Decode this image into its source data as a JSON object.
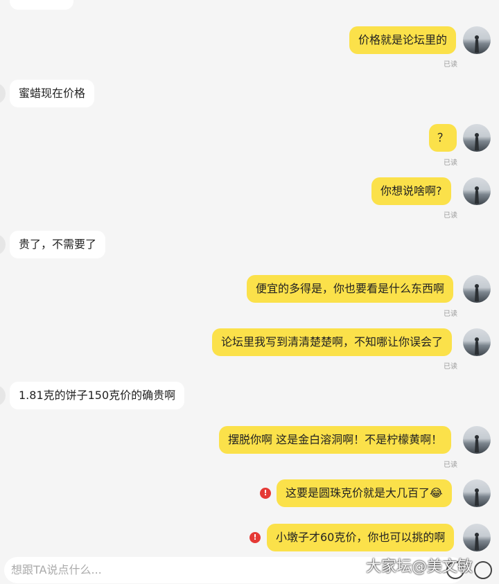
{
  "messages": [
    {
      "dir": "out",
      "text": "价格就是论坛里的",
      "read": "已读",
      "error": false
    },
    {
      "dir": "in",
      "text": "蜜蜡现在价格"
    },
    {
      "dir": "out",
      "text": "？",
      "read": "已读",
      "error": false
    },
    {
      "dir": "out",
      "text": "你想说啥啊?",
      "read": "已读",
      "error": false
    },
    {
      "dir": "in",
      "text": "贵了，不需要了"
    },
    {
      "dir": "out",
      "text": "便宜的多得是，你也要看是什么东西啊",
      "read": "已读",
      "error": false
    },
    {
      "dir": "out",
      "text": "论坛里我写到清清楚楚啊，不知哪让你误会了",
      "read": "已读",
      "error": false
    },
    {
      "dir": "in",
      "text": "1.81克的饼子150克价的确贵啊"
    },
    {
      "dir": "out",
      "text": "摆脱你啊 这是金白溶洞啊！不是柠檬黄啊！",
      "read": "已读",
      "error": false
    },
    {
      "dir": "out",
      "text": "这要是圆珠克价就是大几百了😂",
      "error": true
    },
    {
      "dir": "out",
      "text": "小墩子才60克价，你也可以挑的啊",
      "error": true
    }
  ],
  "error_symbol": "!",
  "input": {
    "placeholder": "想跟TA说点什么..."
  },
  "watermark": "大家坛@美文敏",
  "colors": {
    "outgoing_bubble": "#fbe14a",
    "incoming_bubble": "#ffffff",
    "background": "#f5f5f5",
    "error": "#e53935"
  }
}
